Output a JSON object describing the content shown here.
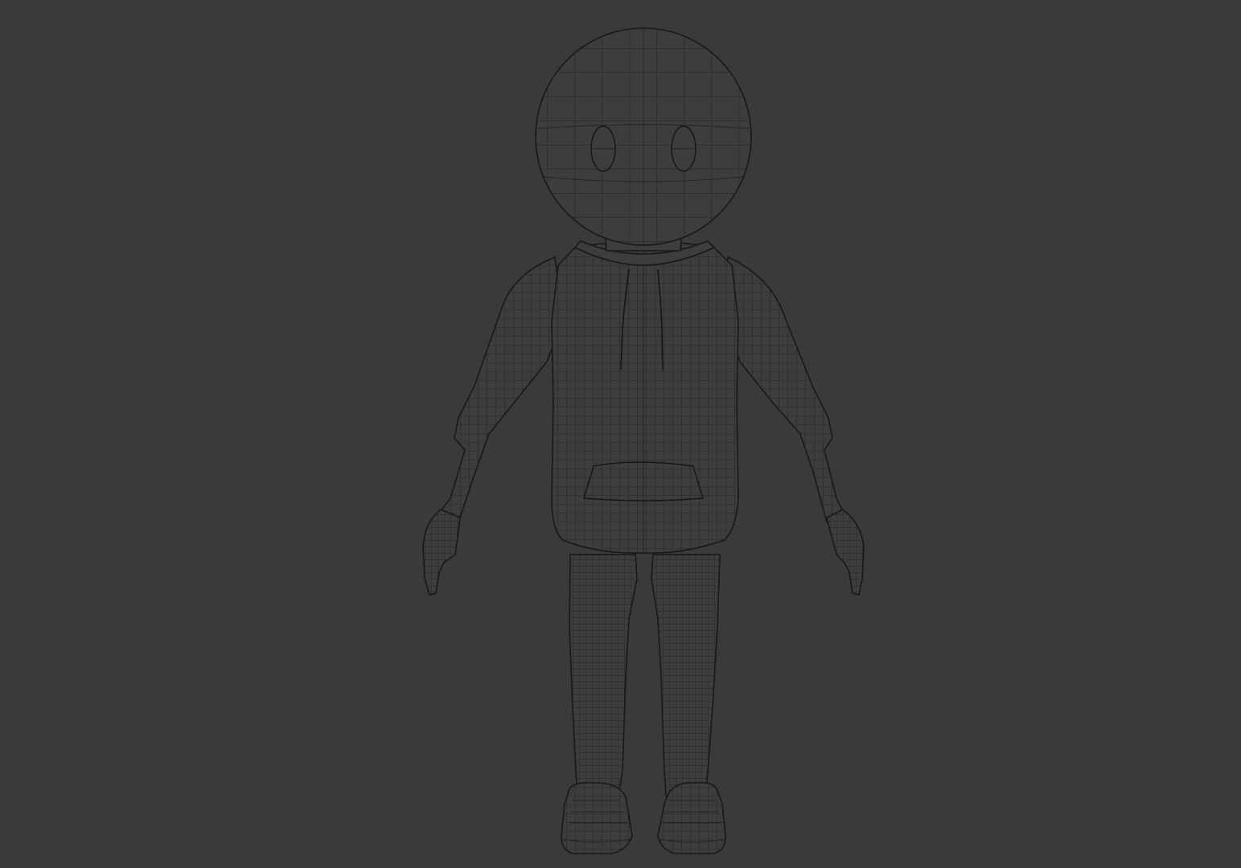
{
  "viewport": {
    "background_color": "#3a3a3a",
    "wire_color": "#1c1c1c",
    "shading": "wireframe",
    "view": "front",
    "model": {
      "pose": "A-pose",
      "parts": [
        "head",
        "eyes",
        "hoodie",
        "drawstrings",
        "front-pocket",
        "arms",
        "hands",
        "legs",
        "sneakers"
      ]
    }
  }
}
